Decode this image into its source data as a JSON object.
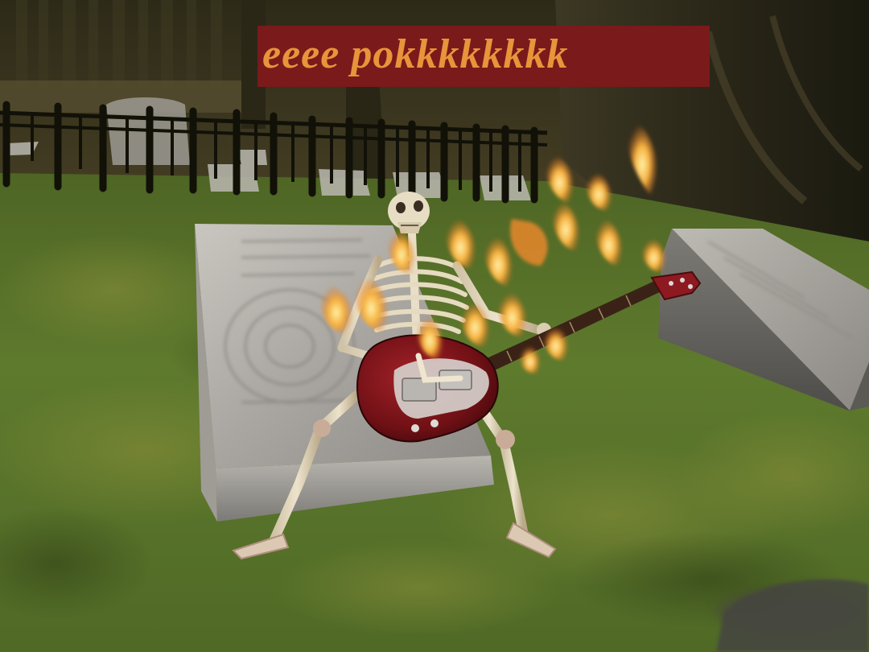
{
  "caption": {
    "text": "eeee pokkkkkkkk"
  },
  "colors": {
    "banner_background": "#7a1a1b",
    "banner_text": "#e8943b",
    "grass": "#5f7a2c",
    "fire": "#f39a2a",
    "guitar_body": "#7a1216"
  }
}
